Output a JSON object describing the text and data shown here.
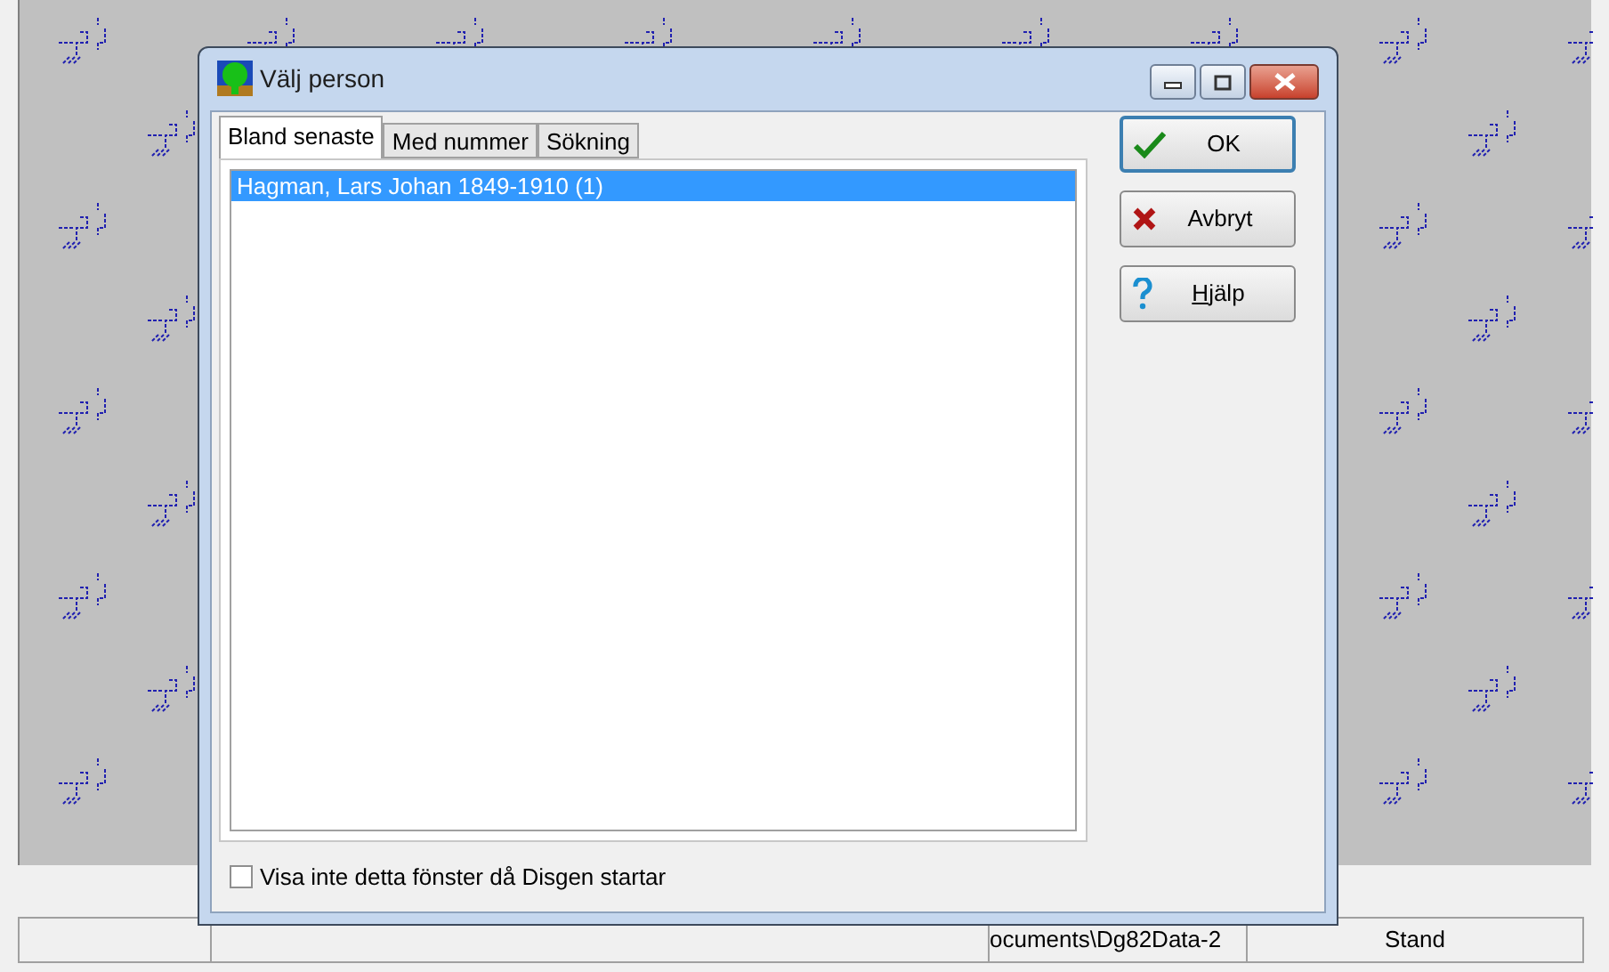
{
  "dialog": {
    "title": "Välj person",
    "window_buttons": [
      {
        "kind": "minimize"
      },
      {
        "kind": "maximize"
      },
      {
        "kind": "close"
      }
    ],
    "tabs": [
      {
        "label": "Bland senaste",
        "selected": true
      },
      {
        "label": "Med nummer",
        "selected": false
      },
      {
        "label": "Sökning",
        "selected": false
      }
    ],
    "list_items": [
      {
        "label": "Hagman, Lars Johan 1849-1910 (1)",
        "selected": true
      }
    ],
    "buttons": [
      {
        "label": "OK",
        "kind": "ok"
      },
      {
        "label": "Avbryt",
        "kind": "cancel"
      },
      {
        "label": "Hjälp",
        "kind": "help"
      }
    ],
    "checkbox": {
      "label": "Visa inte detta fönster då Disgen startar",
      "checked": false
    }
  },
  "status_bar": [
    "ocuments\\Dg82Data-2",
    "Stand"
  ]
}
